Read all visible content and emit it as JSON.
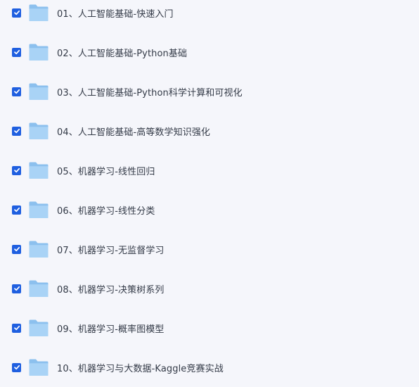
{
  "file_list": {
    "items": [
      {
        "name": "01、人工智能基础-快速入门",
        "checked": true,
        "icon": "folder-icon"
      },
      {
        "name": "02、人工智能基础-Python基础",
        "checked": true,
        "icon": "folder-icon"
      },
      {
        "name": "03、人工智能基础-Python科学计算和可视化",
        "checked": true,
        "icon": "folder-icon"
      },
      {
        "name": "04、人工智能基础-高等数学知识强化",
        "checked": true,
        "icon": "folder-icon"
      },
      {
        "name": "05、机器学习-线性回归",
        "checked": true,
        "icon": "folder-icon"
      },
      {
        "name": "06、机器学习-线性分类",
        "checked": true,
        "icon": "folder-icon"
      },
      {
        "name": "07、机器学习-无监督学习",
        "checked": true,
        "icon": "folder-icon"
      },
      {
        "name": "08、机器学习-决策树系列",
        "checked": true,
        "icon": "folder-icon"
      },
      {
        "name": "09、机器学习-概率图模型",
        "checked": true,
        "icon": "folder-icon"
      },
      {
        "name": "10、机器学习与大数据-Kaggle竞赛实战",
        "checked": true,
        "icon": "folder-icon"
      }
    ]
  },
  "colors": {
    "background": "#f5f6fb",
    "checkbox": "#1f5fe0",
    "folder_back": "#8cc0ee",
    "folder_front": "#a9d3f6",
    "text": "#333a47"
  }
}
